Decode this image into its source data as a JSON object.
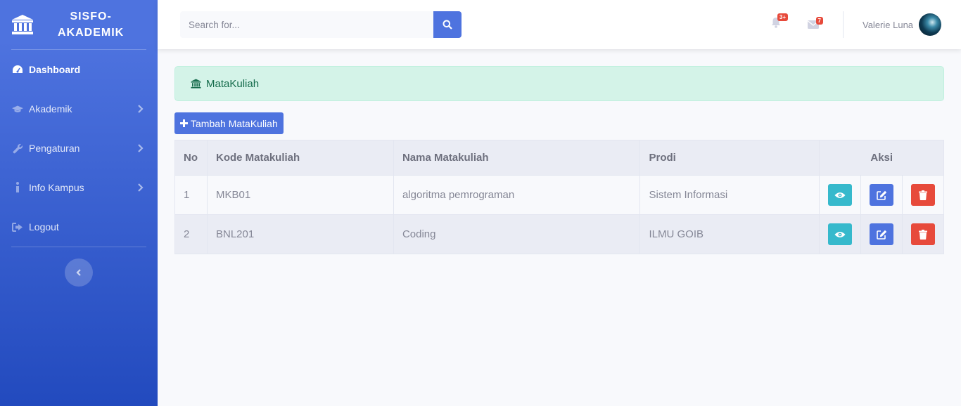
{
  "brand": {
    "line1": "SISFO-",
    "line2": "AKADEMIK"
  },
  "sidebar": {
    "items": [
      {
        "label": "Dashboard",
        "icon": "dashboard-icon",
        "active": true
      },
      {
        "label": "Akademik",
        "icon": "graduation-cap-icon"
      },
      {
        "label": "Pengaturan",
        "icon": "wrench-icon"
      },
      {
        "label": "Info Kampus",
        "icon": "info-icon"
      },
      {
        "label": "Logout",
        "icon": "sign-out-icon"
      }
    ]
  },
  "topbar": {
    "search_placeholder": "Search for...",
    "alerts_badge": "3+",
    "messages_badge": "7",
    "user_name": "Valerie Luna"
  },
  "page": {
    "alert_title": "MataKuliah",
    "add_button": "Tambah MataKuliah"
  },
  "table": {
    "headers": {
      "no": "No",
      "kode": "Kode Matakuliah",
      "nama": "Nama Matakuliah",
      "prodi": "Prodi",
      "aksi": "Aksi"
    },
    "rows": [
      {
        "no": "1",
        "kode": "MKB01",
        "nama": "algoritma pemrograman",
        "prodi": "Sistem Informasi"
      },
      {
        "no": "2",
        "kode": "BNL201",
        "nama": "Coding",
        "prodi": "ILMU GOIB"
      }
    ]
  },
  "colors": {
    "primary": "#4e73df",
    "info": "#36b9cc",
    "danger": "#e74a3b",
    "success_bg": "#d4f3e8"
  }
}
